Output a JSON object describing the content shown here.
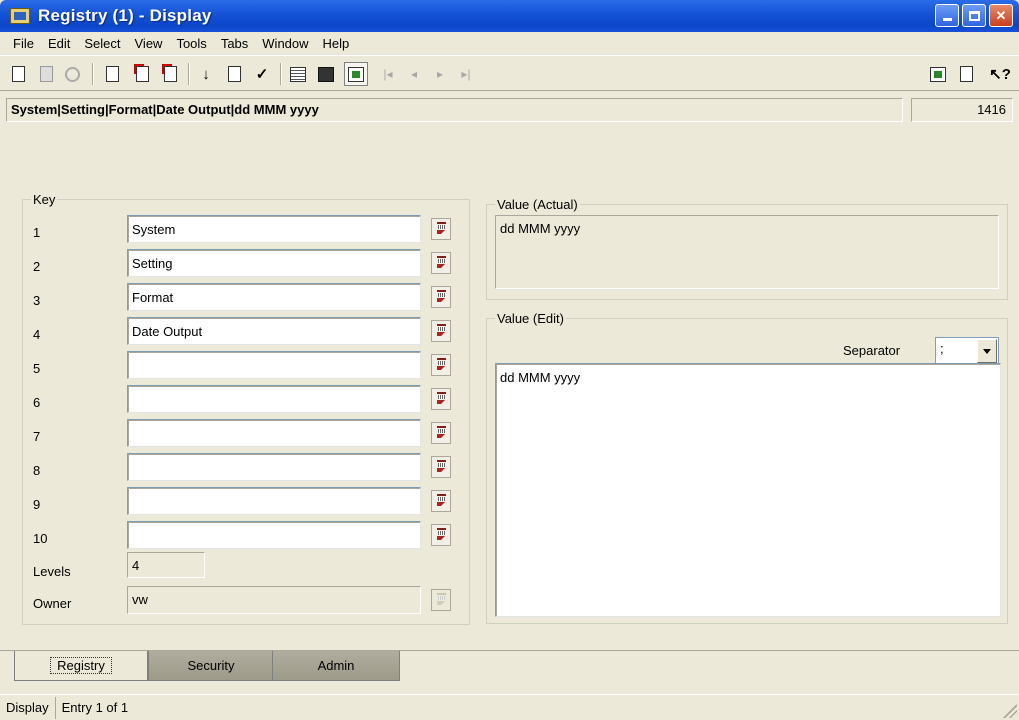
{
  "window": {
    "title": "Registry (1) - Display"
  },
  "menu": [
    "File",
    "Edit",
    "Select",
    "View",
    "Tools",
    "Tabs",
    "Window",
    "Help"
  ],
  "path": {
    "text": "System|Setting|Format|Date Output|dd MMM yyyy",
    "count": "1416"
  },
  "key_group": {
    "label": "Key",
    "rows": [
      {
        "num": "1",
        "value": "System"
      },
      {
        "num": "2",
        "value": "Setting"
      },
      {
        "num": "3",
        "value": "Format"
      },
      {
        "num": "4",
        "value": "Date Output"
      },
      {
        "num": "5",
        "value": ""
      },
      {
        "num": "6",
        "value": ""
      },
      {
        "num": "7",
        "value": ""
      },
      {
        "num": "8",
        "value": ""
      },
      {
        "num": "9",
        "value": ""
      },
      {
        "num": "10",
        "value": ""
      }
    ],
    "levels_label": "Levels",
    "levels_value": "4",
    "owner_label": "Owner",
    "owner_value": "vw"
  },
  "value_actual": {
    "label": "Value (Actual)",
    "text": "dd MMM yyyy"
  },
  "value_edit": {
    "label": "Value (Edit)",
    "separator_label": "Separator",
    "separator_value": ";",
    "text": "dd MMM yyyy"
  },
  "tabs": [
    "Registry",
    "Security",
    "Admin"
  ],
  "status": {
    "mode": "Display",
    "entry": "Entry 1 of 1"
  }
}
